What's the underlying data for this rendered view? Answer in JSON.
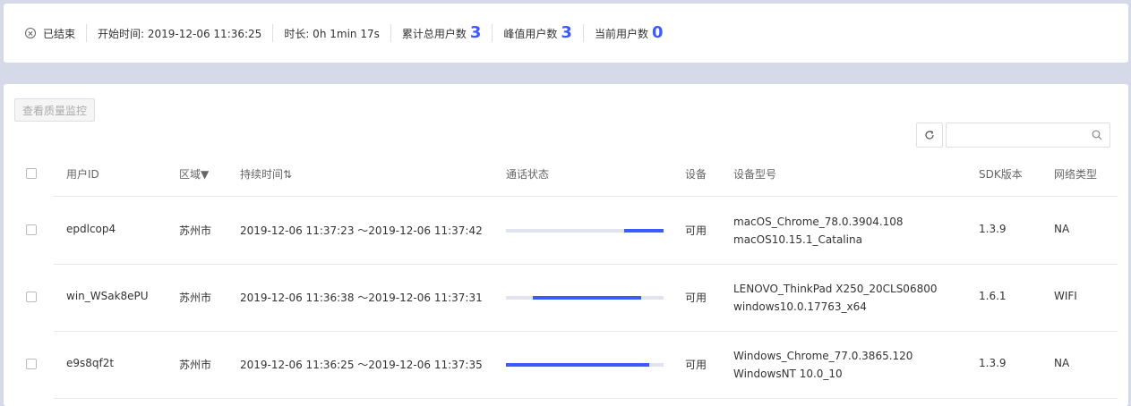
{
  "summary": {
    "status_label": "已结束",
    "start_time_label": "开始时间: 2019-12-06 11:36:25",
    "duration_label": "时长: 0h 1min 17s",
    "total_users_label": "累计总用户数",
    "total_users_value": "3",
    "peak_users_label": "峰值用户数",
    "peak_users_value": "3",
    "current_users_label": "当前用户数",
    "current_users_value": "0"
  },
  "toolbar": {
    "quality_button_label": "查看质量监控",
    "search_placeholder": ""
  },
  "table": {
    "headers": {
      "user_id": "用户ID",
      "region": "区域▼",
      "duration": "持续时间⇅",
      "call_status": "通话状态",
      "device": "设备",
      "device_model": "设备型号",
      "sdk_version": "SDK版本",
      "network_type": "网络类型"
    },
    "rows": [
      {
        "user_id": "epdlcop4",
        "region": "苏州市",
        "time_range": "2019-12-06 11:37:23 ～2019-12-06 11:37:42",
        "call_status": {
          "start": 0.75,
          "end": 1.0
        },
        "device": "可用",
        "model_line1": "macOS_Chrome_78.0.3904.108",
        "model_line2": "macOS10.15.1_Catalina",
        "sdk": "1.3.9",
        "network": "NA"
      },
      {
        "user_id": "win_WSak8ePU",
        "region": "苏州市",
        "time_range": "2019-12-06 11:36:38 ～2019-12-06 11:37:31",
        "call_status": {
          "start": 0.17,
          "end": 0.86
        },
        "device": "可用",
        "model_line1": "LENOVO_ThinkPad X250_20CLS06800",
        "model_line2": "windows10.0.17763_x64",
        "sdk": "1.6.1",
        "network": "WIFI"
      },
      {
        "user_id": "e9s8qf2t",
        "region": "苏州市",
        "time_range": "2019-12-06 11:36:25 ～2019-12-06 11:37:35",
        "call_status": {
          "start": 0.0,
          "end": 0.91
        },
        "device": "可用",
        "model_line1": "Windows_Chrome_77.0.3865.120",
        "model_line2": "WindowsNT 10.0_10",
        "sdk": "1.3.9",
        "network": "NA"
      }
    ]
  },
  "colors": {
    "accent": "#3d5afe",
    "track": "#e1e4ef",
    "background": "#d5d9e8"
  }
}
